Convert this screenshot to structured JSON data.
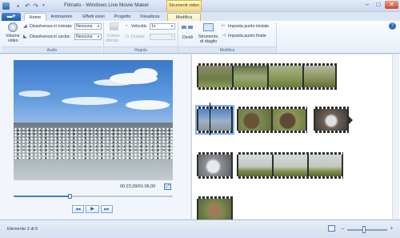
{
  "window": {
    "title": "Filmato - Windows Live Movie Maker",
    "context_tab_group": "Strumenti video",
    "controls": {
      "minimize": "–",
      "maximize": "□",
      "close": "✕"
    }
  },
  "quick_access": {
    "save_icon": "disk-icon",
    "undo_icon": "undo-icon",
    "redo_icon": "redo-icon"
  },
  "tabs": [
    {
      "label": "Home"
    },
    {
      "label": "Animazioni"
    },
    {
      "label": "Effetti visivi"
    },
    {
      "label": "Progetto"
    },
    {
      "label": "Visualizza"
    },
    {
      "label": "Modifica",
      "active": true
    }
  ],
  "ribbon": {
    "audio": {
      "group_label": "Audio",
      "volume_label_1": "Volume",
      "volume_label_2": "video",
      "fade_in_label": "Dissolvenza in entrata:",
      "fade_in_value": "Nessuna",
      "fade_out_label": "Dissolvenza in uscita:",
      "fade_out_value": "Nessuna"
    },
    "regola": {
      "group_label": "Regola",
      "bg_color_label_1": "Colore",
      "bg_color_label_2": "sfondo",
      "speed_label": "Velocità:",
      "speed_value": "1x",
      "duration_label": "Durata:",
      "duration_value": ""
    },
    "modifica": {
      "group_label": "Modifica",
      "split_label": "Dividi",
      "trim_label_1": "Strumento",
      "trim_label_2": "di ritaglio",
      "set_start_label": "Imposta punto iniziale",
      "set_end_label": "Imposta punto finale"
    }
  },
  "preview": {
    "timecode": "00:23,39/01:06,00",
    "progress": 0.35,
    "controls": {
      "prev": "◀◀",
      "play": "▶",
      "next": "▶▶"
    }
  },
  "status": {
    "text": "Elemento 2 di 6"
  },
  "zoom": {
    "level": 0.42
  }
}
